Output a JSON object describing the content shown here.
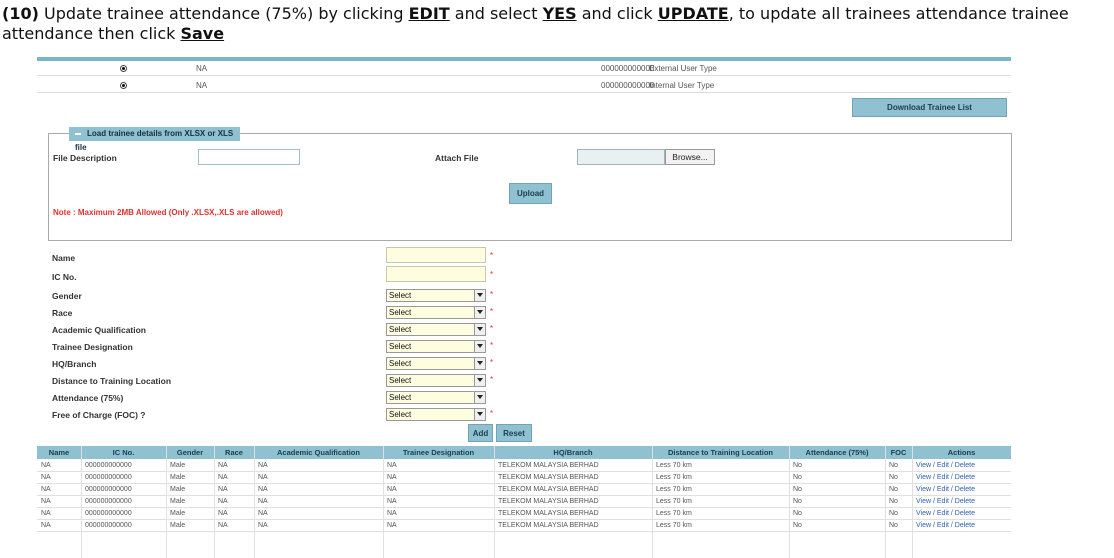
{
  "instruction": {
    "step": "(10)",
    "t1": " Update trainee attendance (75%) by clicking ",
    "edit": "EDIT",
    "t2": " and select ",
    "yes": "YES",
    "t3": " and click ",
    "update": "UPDATE",
    "t4": ", to update all trainees attendance trainee attendance then click ",
    "save": "Save"
  },
  "user_types": [
    {
      "name": "NA",
      "ic": "000000000000",
      "type": "External User Type"
    },
    {
      "name": "NA",
      "ic": "000000000000",
      "type": "Internal User Type"
    }
  ],
  "download_button": "Download Trainee List",
  "upload_section": {
    "legend": "Load trainee details from XLSX or XLS file",
    "file_description_label": "File Description",
    "attach_file_label": "Attach File",
    "browse_label": "Browse...",
    "upload_button": "Upload",
    "note": "Note : Maximum 2MB Allowed (Only .XLSX,.XLS are allowed)"
  },
  "form": {
    "name_label": "Name",
    "ic_label": "IC No.",
    "gender_label": "Gender",
    "race_label": "Race",
    "academic_label": "Academic Qualification",
    "designation_label": "Trainee Designation",
    "hq_label": "HQ/Branch",
    "distance_label": "Distance to Training Location",
    "attendance_label": "Attendance (75%)",
    "foc_label": "Free of Charge (FOC) ?",
    "select_value": "Select",
    "required": "*",
    "add_button": "Add",
    "reset_button": "Reset"
  },
  "table": {
    "headers": [
      "Name",
      "IC No.",
      "Gender",
      "Race",
      "Academic Qualification",
      "Trainee Designation",
      "HQ/Branch",
      "Distance to Training Location",
      "Attendance (75%)",
      "FOC",
      "Actions"
    ],
    "rows": [
      [
        "NA",
        "000000000000",
        "Male",
        "NA",
        "NA",
        "NA",
        "TELEKOM MALAYSIA BERHAD",
        "Less 70 km",
        "No",
        "No",
        "View / Edit / Delete"
      ],
      [
        "NA",
        "000000000000",
        "Male",
        "NA",
        "NA",
        "NA",
        "TELEKOM MALAYSIA BERHAD",
        "Less 70 km",
        "No",
        "No",
        "View / Edit / Delete"
      ],
      [
        "NA",
        "000000000000",
        "Male",
        "NA",
        "NA",
        "NA",
        "TELEKOM MALAYSIA BERHAD",
        "Less 70 km",
        "No",
        "No",
        "View / Edit / Delete"
      ],
      [
        "NA",
        "000000000000",
        "Male",
        "NA",
        "NA",
        "NA",
        "TELEKOM MALAYSIA BERHAD",
        "Less 70 km",
        "No",
        "No",
        "View / Edit / Delete"
      ],
      [
        "NA",
        "000000000000",
        "Male",
        "NA",
        "NA",
        "NA",
        "TELEKOM MALAYSIA BERHAD",
        "Less 70 km",
        "No",
        "No",
        "View / Edit / Delete"
      ],
      [
        "NA",
        "000000000000",
        "Male",
        "NA",
        "NA",
        "NA",
        "TELEKOM MALAYSIA BERHAD",
        "Less 70 km",
        "No",
        "No",
        "View / Edit / Delete"
      ]
    ]
  },
  "colors": {
    "header_bg": "#8fc1d1",
    "required": "#e03030",
    "link": "#2b5fb3",
    "select_bg": "#fffde0"
  }
}
